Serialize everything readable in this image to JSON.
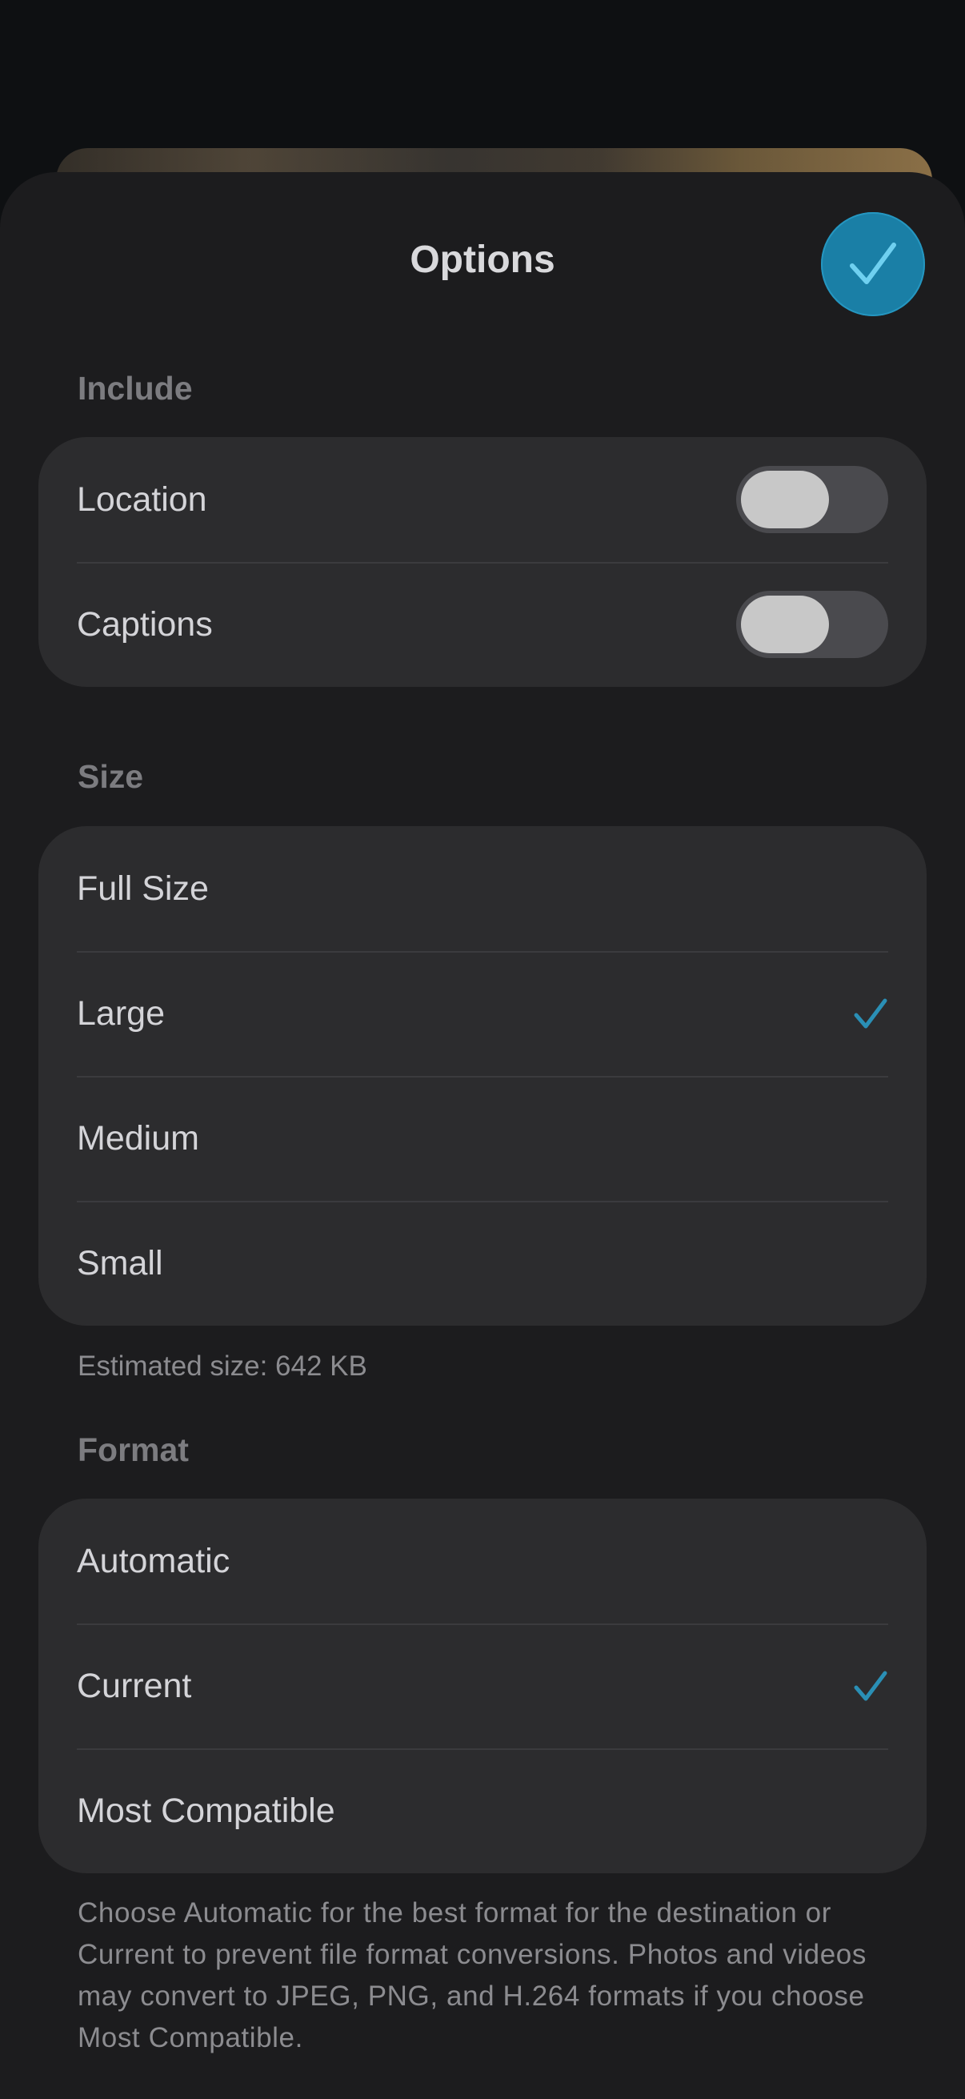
{
  "header": {
    "title": "Options",
    "done_icon": "checkmark-icon"
  },
  "include": {
    "header": "Include",
    "items": [
      {
        "label": "Location",
        "on": false
      },
      {
        "label": "Captions",
        "on": false
      }
    ]
  },
  "size": {
    "header": "Size",
    "items": [
      {
        "label": "Full Size",
        "selected": false
      },
      {
        "label": "Large",
        "selected": true
      },
      {
        "label": "Medium",
        "selected": false
      },
      {
        "label": "Small",
        "selected": false
      }
    ],
    "estimate": "Estimated size: 642 KB"
  },
  "format": {
    "header": "Format",
    "items": [
      {
        "label": "Automatic",
        "selected": false
      },
      {
        "label": "Current",
        "selected": true
      },
      {
        "label": "Most Compatible",
        "selected": false
      }
    ],
    "note": "Choose Automatic for the best format for the destination or Current to prevent file format conversions. Photos and videos may convert to JPEG, PNG, and H.264 formats if you choose Most Compatible."
  },
  "colors": {
    "accent": "#1a7fa6",
    "checkmark": "#2a8fb5",
    "sheet": "#1c1c1e",
    "group": "#2c2c2e"
  }
}
